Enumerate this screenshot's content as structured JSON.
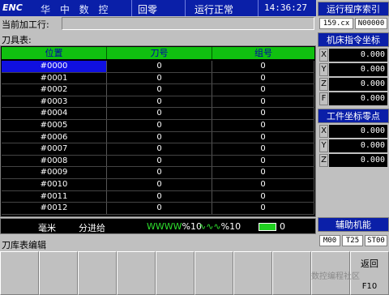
{
  "header": {
    "logo": "ENC",
    "brand": "华 中 数 控",
    "mode": "回零",
    "status": "运行正常",
    "time": "14:36:27"
  },
  "current_line_label": "当前加工行:",
  "tool_table_label": "刀具表:",
  "table": {
    "columns": [
      "位置",
      "刀号",
      "组号"
    ],
    "rows": [
      [
        "#0000",
        "0",
        "0"
      ],
      [
        "#0001",
        "0",
        "0"
      ],
      [
        "#0002",
        "0",
        "0"
      ],
      [
        "#0003",
        "0",
        "0"
      ],
      [
        "#0004",
        "0",
        "0"
      ],
      [
        "#0005",
        "0",
        "0"
      ],
      [
        "#0006",
        "0",
        "0"
      ],
      [
        "#0007",
        "0",
        "0"
      ],
      [
        "#0008",
        "0",
        "0"
      ],
      [
        "#0009",
        "0",
        "0"
      ],
      [
        "#0010",
        "0",
        "0"
      ],
      [
        "#0011",
        "0",
        "0"
      ],
      [
        "#0012",
        "0",
        "0"
      ]
    ]
  },
  "statusbar": {
    "unit": "毫米",
    "feed_mode": "分进给",
    "feed_override_icon": "WWWW",
    "feed_override": "%10",
    "spindle_override_icon": "∿∿∿",
    "spindle_override": "%10",
    "tool_override": "0"
  },
  "menu_label": "刀库表编辑",
  "softkeys": [
    {
      "label": "",
      "fkey": ""
    },
    {
      "label": "",
      "fkey": ""
    },
    {
      "label": "",
      "fkey": ""
    },
    {
      "label": "",
      "fkey": ""
    },
    {
      "label": "",
      "fkey": ""
    },
    {
      "label": "",
      "fkey": ""
    },
    {
      "label": "",
      "fkey": ""
    },
    {
      "label": "",
      "fkey": ""
    },
    {
      "label": "",
      "fkey": ""
    },
    {
      "label": "返回",
      "fkey": "F10"
    }
  ],
  "right_panel": {
    "program_index_label": "运行程序索引",
    "program_line": "159.cx",
    "program_number": "N00000",
    "machine_coord_label": "机床指令坐标",
    "machine_coords": [
      {
        "axis": "X",
        "value": "0.000"
      },
      {
        "axis": "Y",
        "value": "0.000"
      },
      {
        "axis": "Z",
        "value": "0.000"
      },
      {
        "axis": "F",
        "value": "0.000"
      }
    ],
    "work_zero_label": "工件坐标零点",
    "work_coords": [
      {
        "axis": "X",
        "value": "0.000"
      },
      {
        "axis": "Y",
        "value": "0.000"
      },
      {
        "axis": "Z",
        "value": "0.000"
      }
    ],
    "aux_label": "辅助机能",
    "aux_codes": [
      "M00",
      "T25",
      "ST00"
    ]
  },
  "watermark": "数控编程社区",
  "colors": {
    "title_bg": "#0a1fa8",
    "table_header": "#10c010",
    "selection": "#1010e0",
    "panel_bg": "#c0c0c0"
  }
}
